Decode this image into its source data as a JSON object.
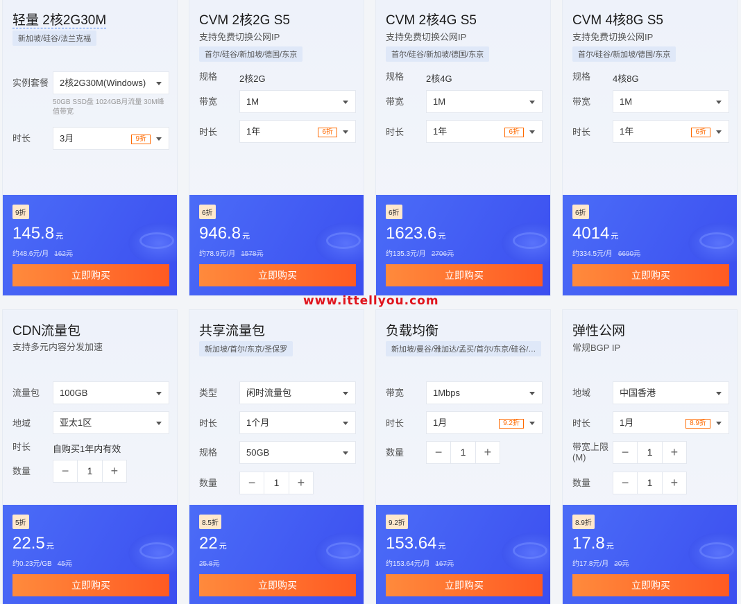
{
  "watermark": "www.ittellyou.com",
  "cards": [
    {
      "title": "轻量 2核2G30M",
      "tags": "新加坡/硅谷/法兰克福",
      "rows": [
        {
          "label": "实例套餐",
          "value": "2核2G30M(Windows)",
          "hint": "50GB SSD盘 1024GB月流量 30M峰值带宽"
        },
        {
          "label": "时长",
          "value": "3月",
          "badge": "9折"
        }
      ],
      "discount": "9折",
      "price": "145.8",
      "unit": "元",
      "per": "约48.6元/月",
      "orig": "162元",
      "buy": "立即购买"
    },
    {
      "title": "CVM 2核2G S5",
      "subtitle": "支持免费切换公网IP",
      "tags": "首尔/硅谷/新加坡/德国/东京",
      "rows": [
        {
          "label": "规格",
          "text": "2核2G"
        },
        {
          "label": "带宽",
          "value": "1M"
        },
        {
          "label": "时长",
          "value": "1年",
          "badge": "6折"
        }
      ],
      "discount": "6折",
      "price": "946.8",
      "unit": "元",
      "per": "约78.9元/月",
      "orig": "1578元",
      "buy": "立即购买"
    },
    {
      "title": "CVM 2核4G S5",
      "subtitle": "支持免费切换公网IP",
      "tags": "首尔/硅谷/新加坡/德国/东京",
      "rows": [
        {
          "label": "规格",
          "text": "2核4G"
        },
        {
          "label": "带宽",
          "value": "1M"
        },
        {
          "label": "时长",
          "value": "1年",
          "badge": "6折"
        }
      ],
      "discount": "6折",
      "price": "1623.6",
      "unit": "元",
      "per": "约135.3元/月",
      "orig": "2706元",
      "buy": "立即购买"
    },
    {
      "title": "CVM 4核8G S5",
      "subtitle": "支持免费切换公网IP",
      "tags": "首尔/硅谷/新加坡/德国/东京",
      "rows": [
        {
          "label": "规格",
          "text": "4核8G"
        },
        {
          "label": "带宽",
          "value": "1M"
        },
        {
          "label": "时长",
          "value": "1年",
          "badge": "6折"
        }
      ],
      "discount": "6折",
      "price": "4014",
      "unit": "元",
      "per": "约334.5元/月",
      "orig": "6690元",
      "buy": "立即购买"
    },
    {
      "title": "CDN流量包",
      "subtitle": "支持多元内容分发加速",
      "rows": [
        {
          "label": "流量包",
          "value": "100GB"
        },
        {
          "label": "地域",
          "value": "亚太1区"
        },
        {
          "label": "时长",
          "text": "自购买1年内有效"
        },
        {
          "label": "数量",
          "stepper": "1"
        }
      ],
      "discount": "5折",
      "price": "22.5",
      "unit": "元",
      "per": "约0.23元/GB",
      "orig": "45元",
      "buy": "立即购买"
    },
    {
      "title": "共享流量包",
      "tags": "新加坡/首尔/东京/圣保罗",
      "rows": [
        {
          "label": "类型",
          "value": "闲时流量包"
        },
        {
          "label": "时长",
          "value": "1个月"
        },
        {
          "label": "规格",
          "value": "50GB"
        },
        {
          "label": "数量",
          "stepper": "1"
        }
      ],
      "discount": "8.5折",
      "price": "22",
      "unit": "元",
      "per": "",
      "orig": "25.8元",
      "buy": "立即购买"
    },
    {
      "title": "负载均衡",
      "tags": "新加坡/曼谷/雅加达/孟买/首尔/东京/硅谷/…",
      "rows": [
        {
          "label": "带宽",
          "value": "1Mbps"
        },
        {
          "label": "时长",
          "value": "1月",
          "badge": "9.2折"
        },
        {
          "label": "数量",
          "stepper": "1"
        }
      ],
      "discount": "9.2折",
      "price": "153.64",
      "unit": "元",
      "per": "约153.64元/月",
      "orig": "167元",
      "buy": "立即购买"
    },
    {
      "title": "弹性公网",
      "subtitle": "常规BGP IP",
      "rows": [
        {
          "label": "地域",
          "value": "中国香港"
        },
        {
          "label": "时长",
          "value": "1月",
          "badge": "8.9折"
        },
        {
          "label": "带宽上限(M)",
          "stepper": "1"
        },
        {
          "label": "数量",
          "stepper": "1"
        }
      ],
      "discount": "8.9折",
      "price": "17.8",
      "unit": "元",
      "per": "约17.8元/月",
      "orig": "20元",
      "buy": "立即购买"
    }
  ]
}
